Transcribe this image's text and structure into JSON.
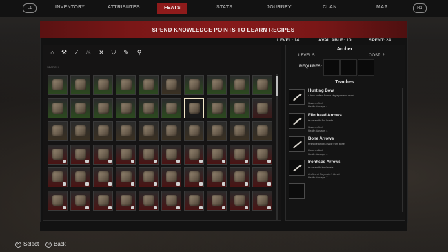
{
  "nav": {
    "left_bumper": "L1",
    "right_bumper": "R1",
    "tabs": [
      "INVENTORY",
      "ATTRIBUTES",
      "FEATS",
      "STATS",
      "JOURNEY",
      "CLAN",
      "MAP"
    ],
    "active_tab": "FEATS"
  },
  "banner": {
    "title": "SPEND KNOWLEDGE POINTS TO LEARN RECIPES"
  },
  "stats": {
    "level": "LEVEL: 14",
    "available": "AVAILABLE: 10",
    "spent": "SPENT: 24"
  },
  "filters": {
    "icons": [
      "home-icon",
      "hammer-icon",
      "knife-icon",
      "fire-icon",
      "crossed-swords-icon",
      "shield-icon",
      "brush-icon",
      "search-icon"
    ],
    "search_placeholder": "SEARCH"
  },
  "grid": {
    "columns": 10,
    "rows": [
      [
        "#2c4a1f",
        "#2c4a1f",
        "#2c4a1f",
        "#2c4a1f",
        "#2c4a1f",
        "#3a3022",
        "#2c4a1f",
        "#2c4a1f",
        "#2c4a1f",
        "#2c4a1f"
      ],
      [
        "#2c4a1f",
        "#2c4a1f",
        "#2c4a1f",
        "#2c4a1f",
        "#2c4a1f",
        "#2c4a1f",
        "#3a3022",
        "#2c4a1f",
        "#2c4a1f",
        "#3a1a1a"
      ],
      [
        "#3a3022",
        "#3a3022",
        "#3a3022",
        "#3a3022",
        "#3a3022",
        "#3a3022",
        "#3a3022",
        "#3a3022",
        "#3a3022",
        "#3a3022"
      ],
      [
        "#4a1414",
        "#4a1414",
        "#4a1414",
        "#4a1414",
        "#4a1414",
        "#4a1414",
        "#4a1414",
        "#4a1414",
        "#4a1414",
        "#4a1414"
      ],
      [
        "#4a1414",
        "#4a1414",
        "#4a1414",
        "#4a1414",
        "#4a1414",
        "#4a1414",
        "#4a1414",
        "#4a1414",
        "#4a1414",
        "#4a1414"
      ],
      [
        "#4a1414",
        "#4a1414",
        "#4a1414",
        "#4a1414",
        "#4a1414",
        "#4a1414",
        "#4a1414",
        "#4a1414",
        "#4a1414",
        "#4a1414"
      ]
    ],
    "selected": [
      1,
      6
    ]
  },
  "selected_feat": {
    "name": "Archer",
    "level": "LEVEL 5",
    "cost": "COST: 2",
    "requires_label": "REQUIRES:"
  },
  "teaches": {
    "title": "Teaches",
    "items": [
      {
        "name": "Hunting Bow",
        "desc": "A bow crafted from a single piece of wood",
        "meta": "Hand crafted",
        "damage": "Health damage: 4"
      },
      {
        "name": "Flinthead Arrows",
        "desc": "Arrows with flint heads",
        "meta": "Hand crafted",
        "damage": "Health damage: 4"
      },
      {
        "name": "Bone Arrows",
        "desc": "Primitive arrows made from bone",
        "meta": "Hand crafted",
        "damage": "Health damage: 4"
      },
      {
        "name": "Ironhead Arrows",
        "desc": "Arrows with iron heads",
        "meta": "Crafted at Carpenter's Bench",
        "damage": "Health damage: 7"
      }
    ]
  },
  "footer": {
    "select": "Select",
    "back": "Back",
    "select_symbol": "✕",
    "back_symbol": "○"
  }
}
